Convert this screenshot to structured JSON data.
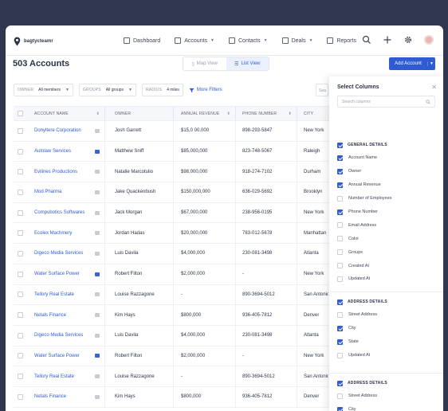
{
  "nav": {
    "logo_text": "bagtycteamr",
    "items": [
      {
        "label": "Dashboard",
        "has_caret": false
      },
      {
        "label": "Accounts",
        "has_caret": true
      },
      {
        "label": "Contacts",
        "has_caret": true
      },
      {
        "label": "Deals",
        "has_caret": true
      },
      {
        "label": "Reports",
        "has_caret": false
      }
    ]
  },
  "page": {
    "title": "503 Accounts",
    "map_view": "Map View",
    "list_view": "List View",
    "add_button": "Add Account"
  },
  "filters": {
    "owner_label": "OWNER",
    "owner_value": "All members",
    "groups_label": "GROUPS",
    "groups_value": "All groups",
    "radius_label": "RADIUS",
    "radius_value": "4 miles",
    "more_filters": "More Filters",
    "search_placeholder": "Sea"
  },
  "table": {
    "headers": {
      "name": "ACCOUNT NAME",
      "owner": "OWNER",
      "revenue": "ANNUAL REVENUE",
      "phone": "PHONE NUMBER",
      "city": "CITY"
    },
    "rows": [
      {
        "name": "Donyltere Corporation",
        "icon": "grey",
        "owner": "Josh Garrett",
        "revenue": "$15,0 00,000",
        "phone": "898-293-5847",
        "city": "New York"
      },
      {
        "name": "Autolaw Services",
        "icon": "blue",
        "owner": "Matthew Sniff",
        "revenue": "$85,000,000",
        "phone": "823-748-5067",
        "city": "Raleigh"
      },
      {
        "name": "Evilines Productions",
        "icon": "grey",
        "owner": "Natalie Marcotulio",
        "revenue": "$98,000,000",
        "phone": "918-274-7102",
        "city": "Durham"
      },
      {
        "name": "Mod Pharma",
        "icon": "grey",
        "owner": "Jake Quackenbush",
        "revenue": "$150,000,000",
        "phone": "636-029-5692",
        "city": "Brooklyn"
      },
      {
        "name": "Compubotics Softwares",
        "icon": "grey",
        "owner": "Jack Morgan",
        "revenue": "$67,000,000",
        "phone": "238-956-0195",
        "city": "New York"
      },
      {
        "name": "Ecolex Machinery",
        "icon": "grey",
        "owner": "Jordan Hadas",
        "revenue": "$20,000,000",
        "phone": "783-012-5678",
        "city": "Manhattan"
      },
      {
        "name": "Digeco Media Services",
        "icon": "grey",
        "owner": "Luis Davila",
        "revenue": "$4,000,000",
        "phone": "230-081-3498",
        "city": "Atlanta"
      },
      {
        "name": "Water Surface Power",
        "icon": "blue",
        "owner": "Robert Filton",
        "revenue": "$2,000,000",
        "phone": "-",
        "city": "New York"
      },
      {
        "name": "Tellory Real Estate",
        "icon": "grey",
        "owner": "Louise Razzagone",
        "revenue": "-",
        "phone": "890-3694-5012",
        "city": "San Antonio"
      },
      {
        "name": "Netals Finance",
        "icon": "grey",
        "owner": "Kim Hays",
        "revenue": "$800,000",
        "phone": "936-405-7812",
        "city": "Denver"
      },
      {
        "name": "Digeco Media Services",
        "icon": "grey",
        "owner": "Luis Davila",
        "revenue": "$4,000,000",
        "phone": "230-081-3498",
        "city": "Atlanta"
      },
      {
        "name": "Water Surface Power",
        "icon": "blue",
        "owner": "Robert Filton",
        "revenue": "$2,000,000",
        "phone": "-",
        "city": "New York"
      },
      {
        "name": "Tellory Real Estate",
        "icon": "grey",
        "owner": "Louise Razzagone",
        "revenue": "-",
        "phone": "890-3694-5012",
        "city": "San Antonio"
      },
      {
        "name": "Netals Finance",
        "icon": "grey",
        "owner": "Kim Hays",
        "revenue": "$800,000",
        "phone": "936-405-7812",
        "city": "Denver"
      }
    ]
  },
  "panel": {
    "title": "Select Columns",
    "search_placeholder": "Search columns",
    "sections": [
      {
        "title": "GENERAL DETAILS",
        "options": [
          {
            "label": "Account Name",
            "checked": true
          },
          {
            "label": "Owner",
            "checked": true
          },
          {
            "label": "Annual Revenue",
            "checked": true
          },
          {
            "label": "Number of Employees",
            "checked": false
          },
          {
            "label": "Phone Number",
            "checked": true
          },
          {
            "label": "Email Address",
            "checked": false
          },
          {
            "label": "Color",
            "checked": false
          },
          {
            "label": "Groups",
            "checked": false
          },
          {
            "label": "Created At",
            "checked": false
          },
          {
            "label": "Updated At",
            "checked": false
          }
        ]
      },
      {
        "title": "ADDRESS DETAILS",
        "options": [
          {
            "label": "Street Address",
            "checked": false
          },
          {
            "label": "City",
            "checked": true
          },
          {
            "label": "State",
            "checked": true
          },
          {
            "label": "Updated At",
            "checked": false
          }
        ]
      },
      {
        "title": "ADDRESS DETAILS",
        "options": [
          {
            "label": "Street Address",
            "checked": false
          },
          {
            "label": "City",
            "checked": true
          },
          {
            "label": "State",
            "checked": true
          }
        ]
      }
    ]
  },
  "colors": {
    "accent": "#2f5bd3",
    "background": "#2f3650"
  }
}
